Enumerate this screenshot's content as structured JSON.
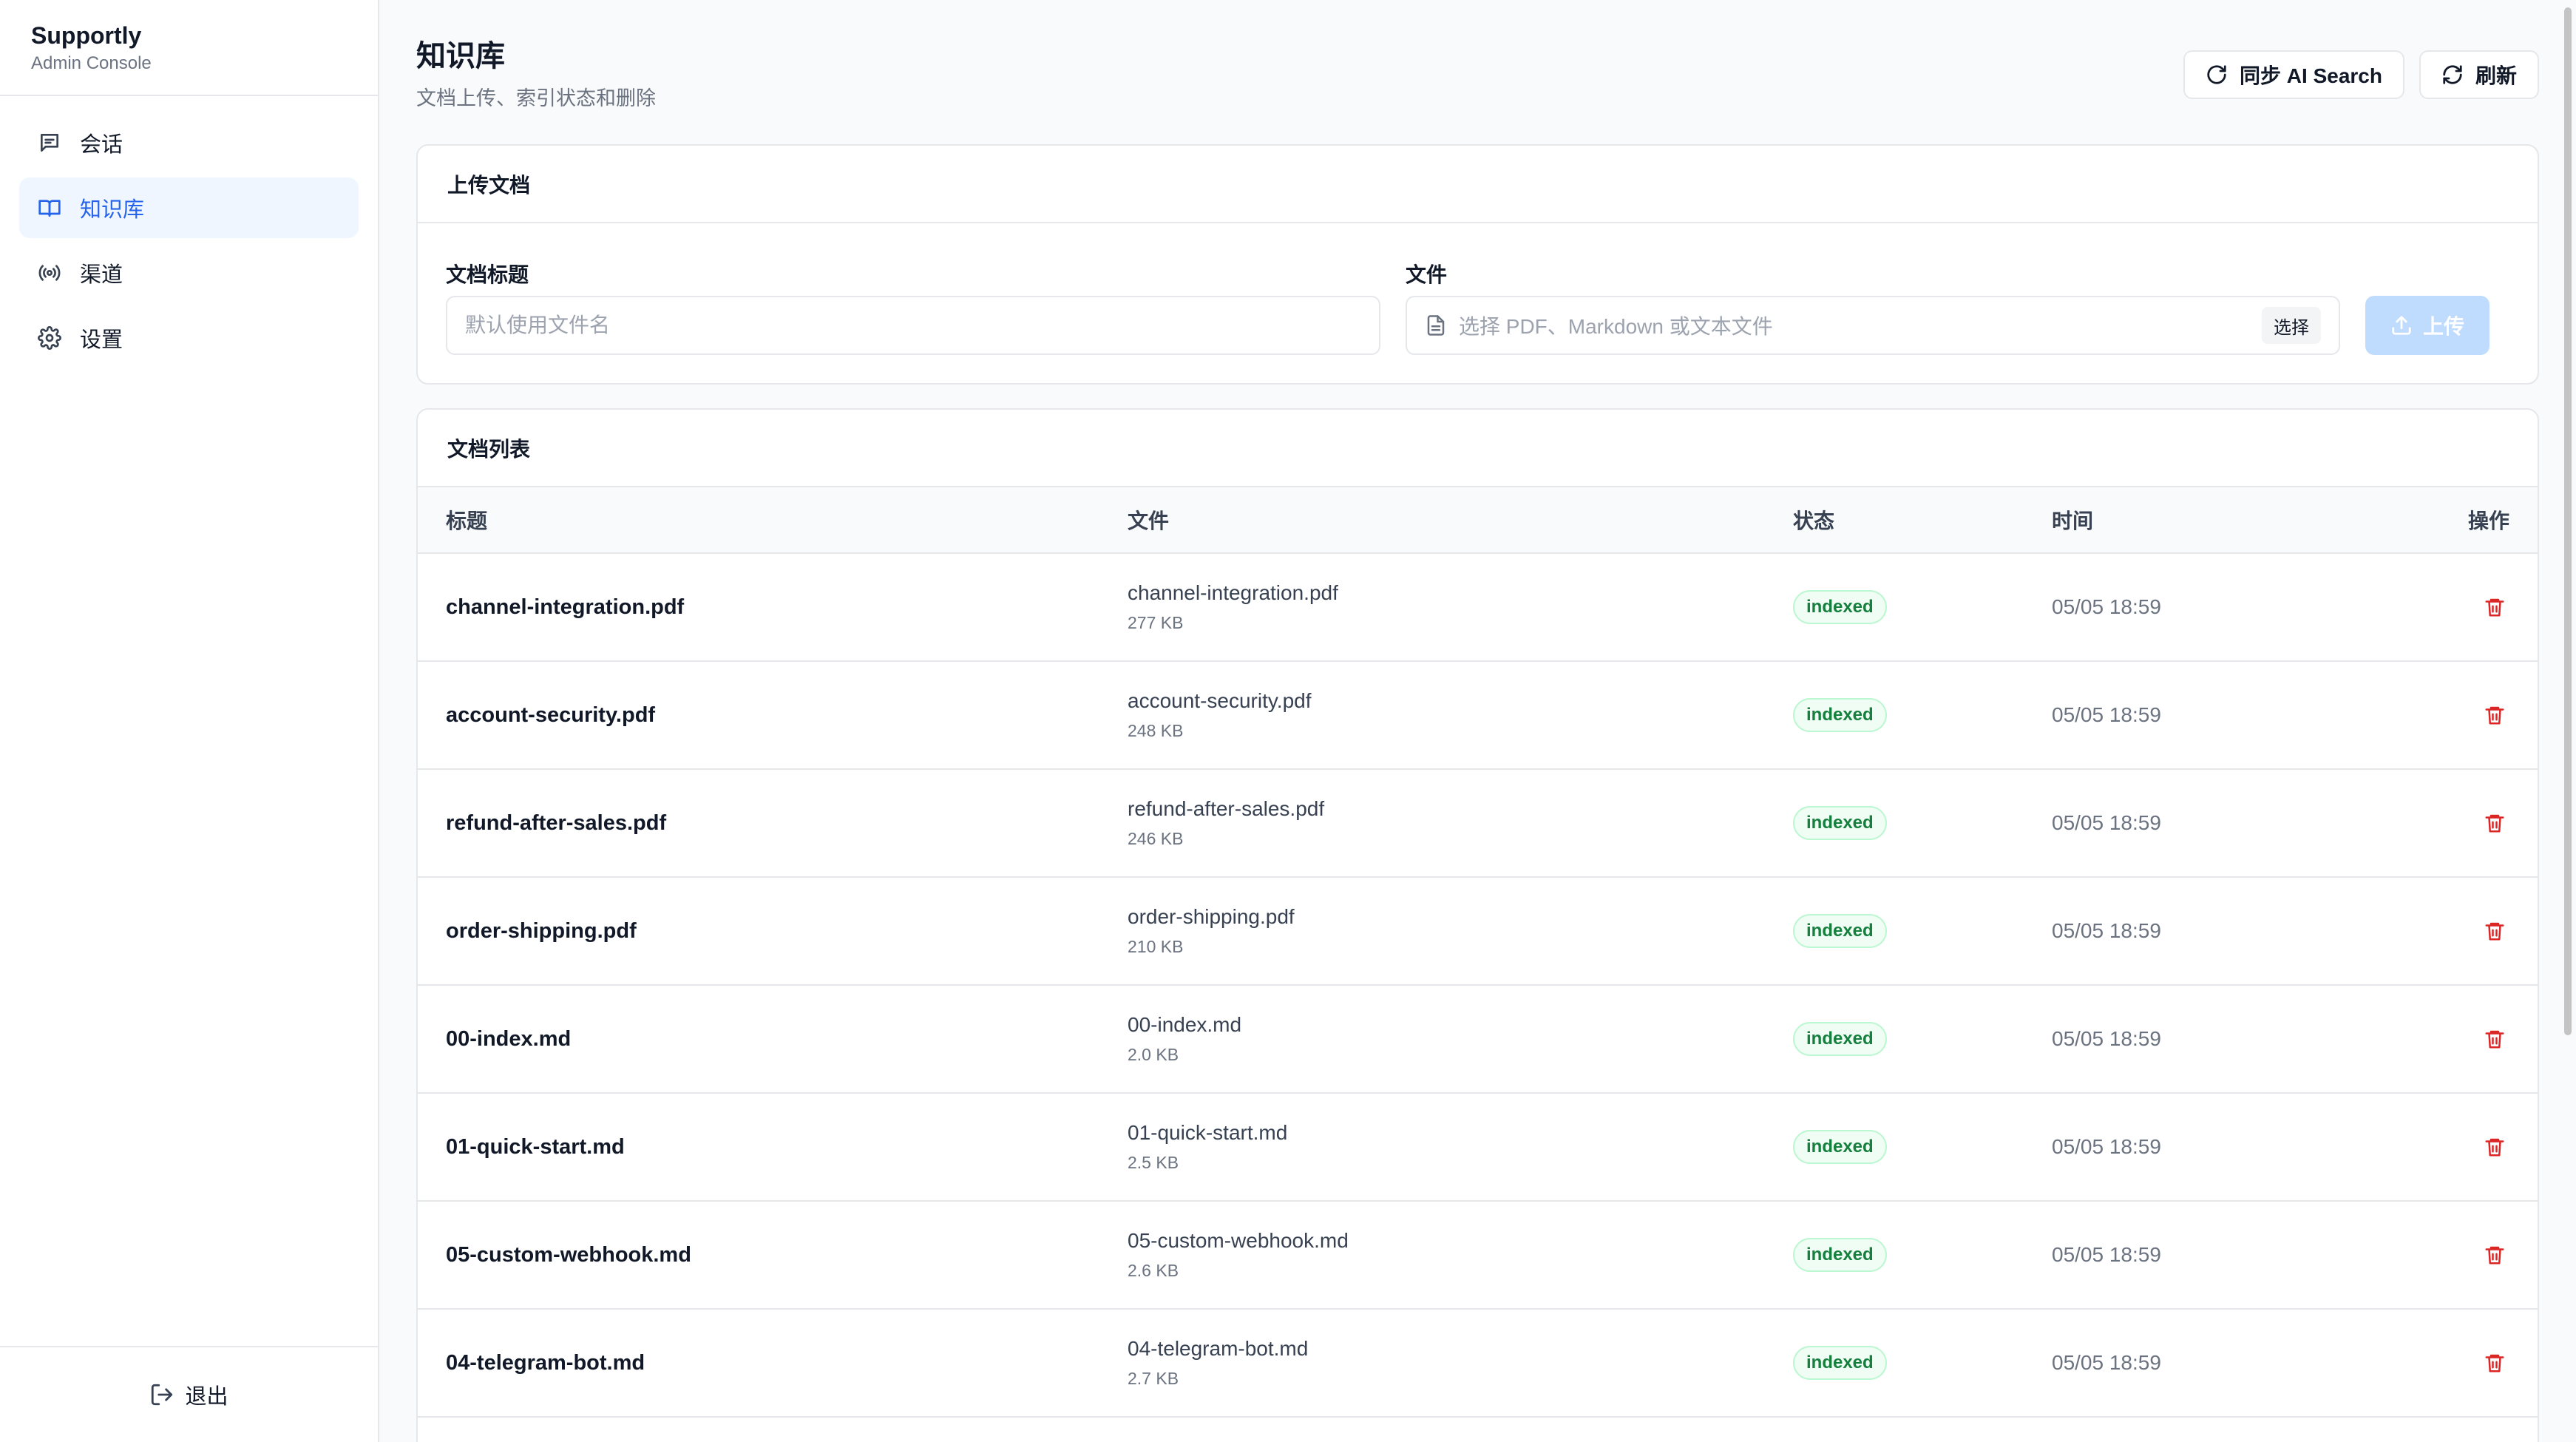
{
  "brand": {
    "name": "Supportly",
    "subtitle": "Admin Console"
  },
  "sidebar": {
    "items": [
      {
        "label": "会话",
        "icon": "chat-icon",
        "active": false
      },
      {
        "label": "知识库",
        "icon": "book-icon",
        "active": true
      },
      {
        "label": "渠道",
        "icon": "broadcast-icon",
        "active": false
      },
      {
        "label": "设置",
        "icon": "gear-icon",
        "active": false
      }
    ],
    "logout_label": "退出"
  },
  "page": {
    "title": "知识库",
    "subtitle": "文档上传、索引状态和删除"
  },
  "header_actions": {
    "sync_label": "同步 AI Search",
    "refresh_label": "刷新"
  },
  "upload": {
    "card_title": "上传文档",
    "title_label": "文档标题",
    "title_placeholder": "默认使用文件名",
    "file_label": "文件",
    "file_placeholder": "选择 PDF、Markdown 或文本文件",
    "choose_label": "选择",
    "upload_label": "上传"
  },
  "documents": {
    "card_title": "文档列表",
    "columns": [
      "标题",
      "文件",
      "状态",
      "时间",
      "操作"
    ],
    "rows": [
      {
        "title": "channel-integration.pdf",
        "file": "channel-integration.pdf",
        "size": "277 KB",
        "status": "indexed",
        "time": "05/05 18:59"
      },
      {
        "title": "account-security.pdf",
        "file": "account-security.pdf",
        "size": "248 KB",
        "status": "indexed",
        "time": "05/05 18:59"
      },
      {
        "title": "refund-after-sales.pdf",
        "file": "refund-after-sales.pdf",
        "size": "246 KB",
        "status": "indexed",
        "time": "05/05 18:59"
      },
      {
        "title": "order-shipping.pdf",
        "file": "order-shipping.pdf",
        "size": "210 KB",
        "status": "indexed",
        "time": "05/05 18:59"
      },
      {
        "title": "00-index.md",
        "file": "00-index.md",
        "size": "2.0 KB",
        "status": "indexed",
        "time": "05/05 18:59"
      },
      {
        "title": "01-quick-start.md",
        "file": "01-quick-start.md",
        "size": "2.5 KB",
        "status": "indexed",
        "time": "05/05 18:59"
      },
      {
        "title": "05-custom-webhook.md",
        "file": "05-custom-webhook.md",
        "size": "2.6 KB",
        "status": "indexed",
        "time": "05/05 18:59"
      },
      {
        "title": "04-telegram-bot.md",
        "file": "04-telegram-bot.md",
        "size": "2.7 KB",
        "status": "indexed",
        "time": "05/05 18:59"
      }
    ]
  },
  "colors": {
    "accent": "#2563eb",
    "active_bg": "#eff6ff",
    "danger": "#dc2626",
    "success": "#15803d"
  }
}
